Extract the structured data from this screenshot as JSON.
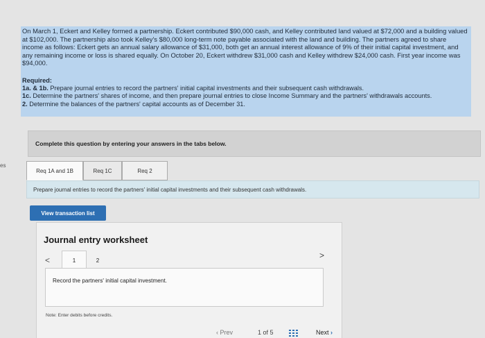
{
  "edge_label": "es",
  "problem": {
    "text": "On March 1, Eckert and Kelley formed a partnership. Eckert contributed $90,000 cash, and Kelley contributed land valued at $72,000 and a building valued at $102,000. The partnership also took Kelley's $80,000 long-term note payable associated with the land and building. The partners agreed to share income as follows: Eckert gets an annual salary allowance of $31,000, both get an annual interest allowance of 9% of their initial capital investment, and any remaining income or loss is shared equally. On October 20, Eckert withdrew $31,000 cash and Kelley withdrew $24,000 cash. First year income was $94,000.",
    "required_title": "Required:",
    "req_1ab_label": "1a. & 1b.",
    "req_1ab_text": " Prepare journal entries to record the partners' initial capital investments and their subsequent cash withdrawals.",
    "req_1c_label": "1c.",
    "req_1c_text": " Determine the partners' shares of income, and then prepare journal entries to close Income Summary and the partners' withdrawals accounts.",
    "req_2_label": "2.",
    "req_2_text": " Determine the balances of the partners' capital accounts as of December 31."
  },
  "instruction": "Complete this question by entering your answers in the tabs below.",
  "tabs": [
    {
      "label": "Req 1A and 1B",
      "active": true
    },
    {
      "label": "Req 1C",
      "active": false
    },
    {
      "label": "Req 2",
      "active": false
    }
  ],
  "task_text": "Prepare journal entries to record the partners' initial capital investments and their subsequent cash withdrawals.",
  "view_button": "View transaction list",
  "worksheet": {
    "title": "Journal entry worksheet",
    "prev_arrow": "<",
    "next_arrow": ">",
    "pages": [
      "1",
      "2"
    ],
    "current_page": "1",
    "entry_text": "Record the partners' initial capital investment.",
    "note": "Note: Enter debits before credits."
  },
  "pager": {
    "prev": "Prev",
    "indicator": "1 of 5",
    "next": "Next"
  },
  "colors": {
    "highlight": "#b9d4ee",
    "button": "#2d6fb3",
    "task_strip": "#d6e7ee"
  },
  "icons": [
    "chevron-left-icon",
    "grid-icon",
    "chevron-right-icon"
  ]
}
